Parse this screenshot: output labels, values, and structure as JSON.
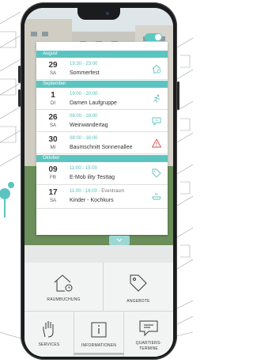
{
  "app": {
    "months": [
      {
        "label": "August"
      },
      {
        "label": "September"
      },
      {
        "label": "Oktober"
      }
    ],
    "events": [
      {
        "day": "29",
        "weekday": "SA",
        "time": "19:30 - 23:00",
        "location": "",
        "title": "Sommerfest",
        "icon": "house-clock-icon"
      },
      {
        "day": "1",
        "weekday": "DI",
        "time": "19:00 - 20:00",
        "location": "",
        "title": "Damen Laufgruppe",
        "icon": "runner-icon"
      },
      {
        "day": "26",
        "weekday": "SA",
        "time": "08:00 - 18:00",
        "location": "",
        "title": "Weinwandertag",
        "icon": "speech-bubble-icon"
      },
      {
        "day": "30",
        "weekday": "MI",
        "time": "08:00 - 16:00",
        "location": "",
        "title": "Baumschnitt Sonnenallee",
        "icon": "warning-icon"
      },
      {
        "day": "09",
        "weekday": "FR",
        "time": "11:00 - 15:00",
        "location": "",
        "title": "E-Mob ility Testtag",
        "icon": "tag-icon"
      },
      {
        "day": "17",
        "weekday": "SA",
        "time": "11:00 - 16:00",
        "location": " · Eventraum",
        "title": "Kinder - Kochkurs",
        "icon": "cooking-pot-icon"
      }
    ],
    "tiles": {
      "raumbuchung": "RAUMBUCHUNG",
      "angebote": "ANGEBOTE",
      "services": "SERVICES",
      "informationen": "INFORMATIONEN",
      "quartierstermine_1": "QUARTIERS-",
      "quartierstermine_2": "TERMINE"
    },
    "colors": {
      "accent": "#5cc4c0",
      "warning": "#e04a4a"
    }
  }
}
